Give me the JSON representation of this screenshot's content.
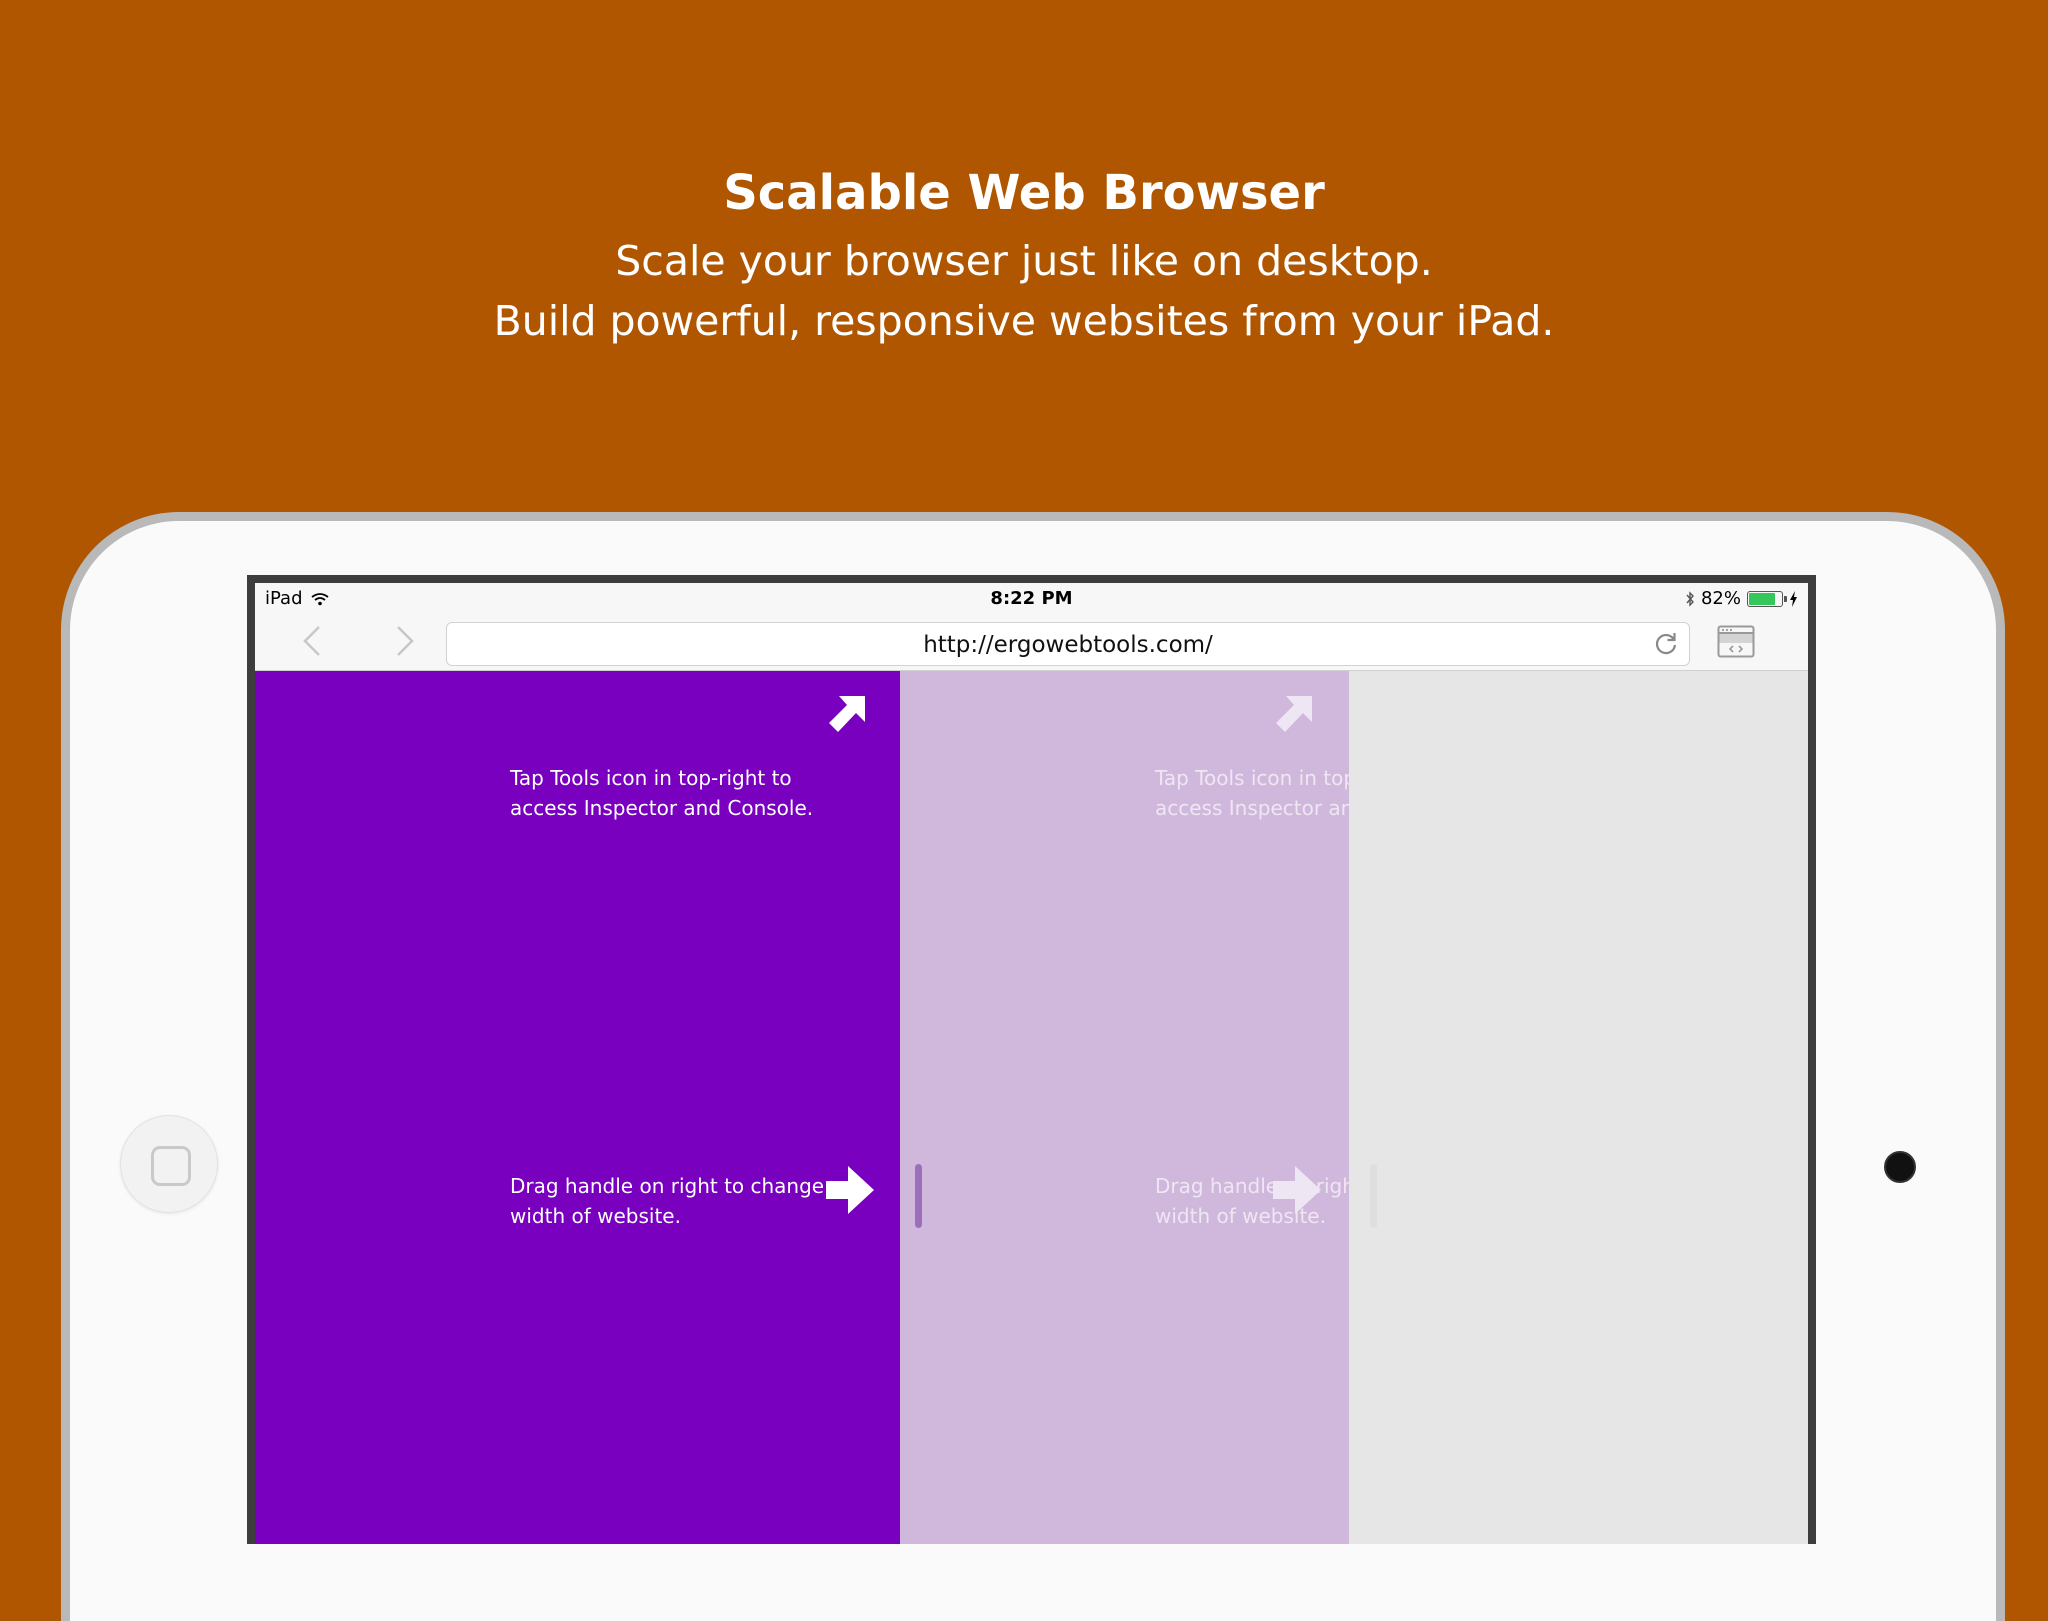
{
  "headline": {
    "title": "Scalable Web Browser",
    "subtitle_line1": "Scale your browser just like on desktop.",
    "subtitle_line2": "Build powerful, responsive websites from your iPad."
  },
  "status_bar": {
    "device": "iPad",
    "time": "8:22 PM",
    "battery_text": "82%",
    "battery_level": 0.82
  },
  "browser": {
    "url": "http://ergowebtools.com/"
  },
  "panels": [
    {
      "tools_hint": "Tap Tools icon in top-right to access Inspector and Console.",
      "drag_hint": "Drag handle on right to change width of website."
    },
    {
      "tools_hint": "Tap Tools icon in top-right to access Inspector and Console.",
      "drag_hint": "Drag handle on right to change width of website."
    }
  ],
  "colors": {
    "background": "#b05600",
    "primary_panel": "#7800be",
    "ghost_panel": "#d0b8dc",
    "empty_area": "#e6e6e6",
    "battery": "#35c759"
  },
  "icons": [
    "wifi-icon",
    "bluetooth-icon",
    "battery-icon",
    "charging-icon",
    "back-chevron-icon",
    "forward-chevron-icon",
    "reload-icon",
    "tools-icon",
    "arrow-up-right-icon",
    "arrow-right-icon"
  ]
}
